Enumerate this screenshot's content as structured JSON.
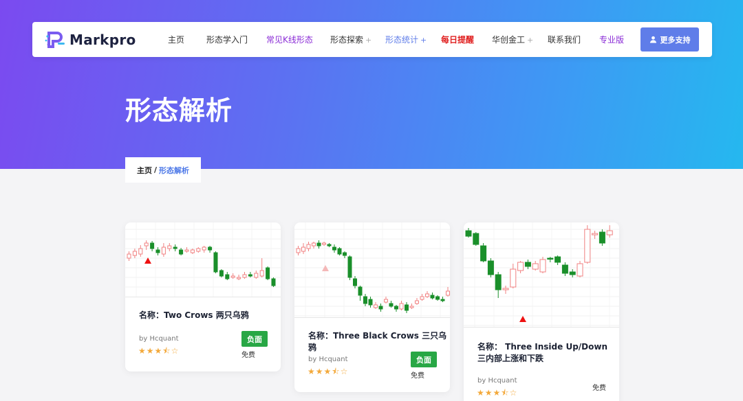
{
  "brand": {
    "name": "Markpro"
  },
  "nav": [
    {
      "label": "主页",
      "color": "#333333",
      "plus": ""
    },
    {
      "label": "形态学入门",
      "color": "#333333",
      "plus": ""
    },
    {
      "label": "常见K线形态",
      "color": "#8a2bd6",
      "plus": ""
    },
    {
      "label": "形态探索",
      "color": "#333333",
      "plus": "+"
    },
    {
      "label": "形态统计",
      "color": "#5f7de9",
      "plus": "+"
    },
    {
      "label": "每日提醒",
      "color": "#e02020",
      "plus": ""
    },
    {
      "label": "华创金工",
      "color": "#333333",
      "plus": "+"
    },
    {
      "label": "联系我们",
      "color": "#333333",
      "plus": ""
    },
    {
      "label": "专业版",
      "color": "#8a2bd6",
      "plus": ""
    }
  ],
  "more_button": "更多支持",
  "page_title": "形态解析",
  "breadcrumb": {
    "home": "主页",
    "separator": "/",
    "current": "形态解析"
  },
  "cards": [
    {
      "name": "名称：Two Crows 两只乌鸦",
      "author": "by Hcquant",
      "stars": "★★★⯪☆",
      "tag": "负面",
      "price": "免费"
    },
    {
      "name": "名称：Three Black Crows 三只乌鸦",
      "author": "by Hcquant",
      "stars": "★★★⯪☆",
      "tag": "负面",
      "price": "免费"
    },
    {
      "name": "名称： Three Inside Up/Down 三内部上涨和下跌",
      "author": "by Hcquant",
      "stars": "★★★⯪☆",
      "tag": "",
      "price": "免费"
    }
  ],
  "colors": {
    "up": "#f08080",
    "down": "#1a8f2a",
    "accent": "#5f7de9",
    "marker_red": "#ee1111",
    "marker_faded": "#f4b8b8"
  }
}
